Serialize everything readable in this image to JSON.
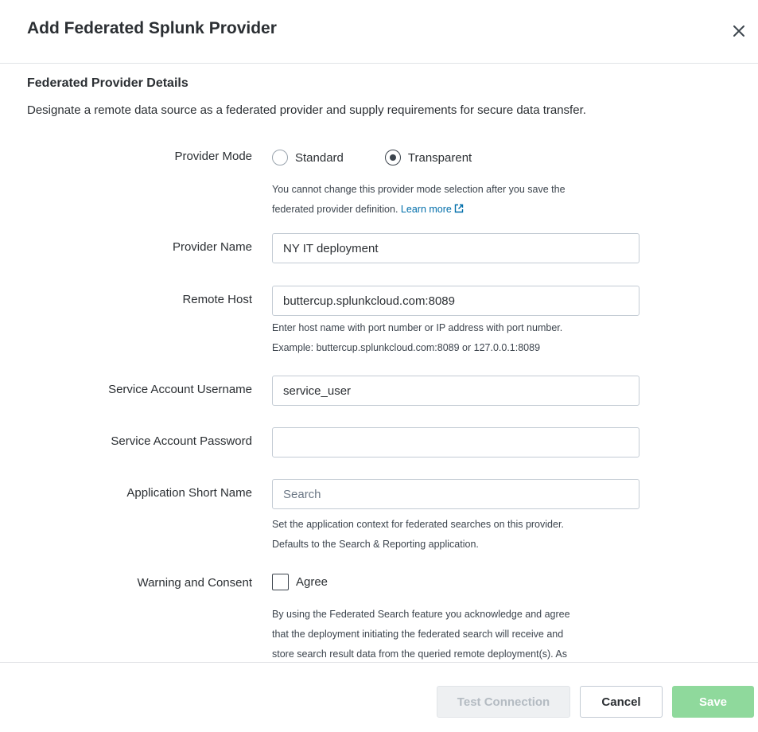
{
  "dialog": {
    "title": "Add Federated Splunk Provider",
    "close_icon": "close-icon"
  },
  "section": {
    "title": "Federated Provider Details",
    "description": "Designate a remote data source as a federated provider and supply requirements for secure data transfer."
  },
  "form": {
    "provider_mode": {
      "label": "Provider Mode",
      "options": [
        {
          "label": "Standard",
          "selected": false
        },
        {
          "label": "Transparent",
          "selected": true
        }
      ],
      "help_line1": "You cannot change this provider mode selection after you save the",
      "help_line2_prefix": "federated provider definition.",
      "help_link": "Learn more",
      "help_link_icon": "external-link-icon"
    },
    "provider_name": {
      "label": "Provider Name",
      "value": "NY IT deployment"
    },
    "remote_host": {
      "label": "Remote Host",
      "value": "buttercup.splunkcloud.com:8089",
      "help_line1": "Enter host name with port number or IP address with port number.",
      "help_line2": "Example: buttercup.splunkcloud.com:8089 or 127.0.0.1:8089"
    },
    "service_username": {
      "label": "Service Account Username",
      "value": "service_user"
    },
    "service_password": {
      "label": "Service Account Password",
      "value": ""
    },
    "app_short_name": {
      "label": "Application Short Name",
      "placeholder": "Search",
      "help_line1": "Set the application context for federated searches on this provider.",
      "help_line2": "Defaults to the Search & Reporting application."
    },
    "warning_consent": {
      "label": "Warning and Consent",
      "checkbox_label": "Agree",
      "checked": false,
      "text_line1": "By using the Federated Search feature you acknowledge and agree",
      "text_line2": "that the deployment initiating the federated search will receive and",
      "text_line3": "store search result data from the queried remote deployment(s). As"
    }
  },
  "footer": {
    "test_connection_label": "Test Connection",
    "cancel_label": "Cancel",
    "save_label": "Save"
  },
  "colors": {
    "link": "#006eaa",
    "save_disabled": "#8fd99c",
    "test_disabled_bg": "#eef0f2"
  }
}
